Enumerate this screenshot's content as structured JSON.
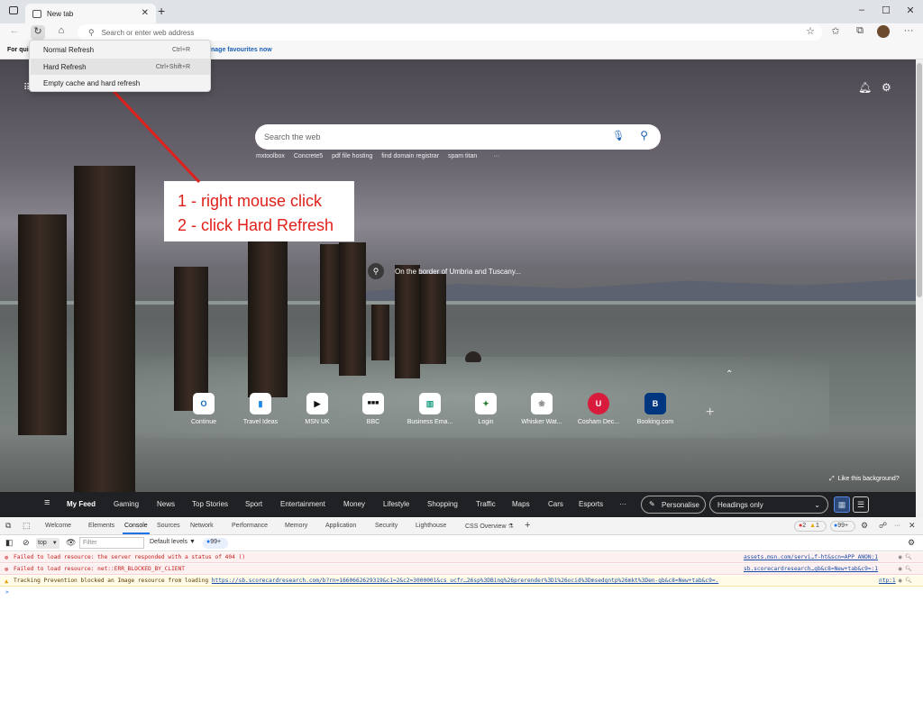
{
  "browser": {
    "tab_title": "New tab",
    "address_placeholder": "Search or enter web address",
    "window_controls": {
      "minimize": "–",
      "maximize": "☐",
      "close": "✕"
    },
    "fav_bar_text": "For qui",
    "fav_bar_link": "nage favourites now"
  },
  "context_menu": {
    "items": [
      {
        "label": "Normal Refresh",
        "shortcut": "Ctrl+R"
      },
      {
        "label": "Hard Refresh",
        "shortcut": "Ctrl+Shift+R"
      },
      {
        "label": "Empty cache and hard refresh",
        "shortcut": ""
      }
    ]
  },
  "ntp": {
    "search_placeholder": "Search the web",
    "suggestions": [
      "mxtoolbox",
      "Concrete5",
      "pdf file hosting",
      "find domain registrar",
      "spam titan",
      "···"
    ],
    "caption": "On the border of Umbria and Tuscany...",
    "like_background": "Like this background?",
    "quick_links": [
      {
        "label": "Continue",
        "icon_text": "O",
        "color": "#0f6cbd"
      },
      {
        "label": "Travel Ideas",
        "icon_text": "▮",
        "color": "#1e88e5"
      },
      {
        "label": "MSN UK",
        "icon_text": "▶",
        "color": "#111111"
      },
      {
        "label": "BBC",
        "icon_text": "■■■",
        "color": "#111111"
      },
      {
        "label": "Business Ema...",
        "icon_text": "▥",
        "color": "#1a9e82"
      },
      {
        "label": "Login",
        "icon_text": "✦",
        "color": "#2e7d32"
      },
      {
        "label": "Whisker Wat...",
        "icon_text": "❀",
        "color": "#888888"
      },
      {
        "label": "Cosham Dec...",
        "icon_text": "U",
        "color": "#d81b3c"
      },
      {
        "label": "Booking.com",
        "icon_text": "B",
        "color": "#003580"
      }
    ]
  },
  "annotation": {
    "line1": "1 - right mouse click",
    "line2": "2 - click Hard Refresh"
  },
  "feed_nav": {
    "items": [
      "My Feed",
      "Gaming",
      "News",
      "Top Stories",
      "Sport",
      "Entertainment",
      "Money",
      "Lifestyle",
      "Shopping",
      "Traffic",
      "Maps",
      "Cars",
      "Esports",
      "···"
    ],
    "personalise": "Personalise",
    "headings": "Headings only"
  },
  "devtools": {
    "tabs": [
      "Welcome",
      "Elements",
      "Console",
      "Sources",
      "Network",
      "Performance",
      "Memory",
      "Application",
      "Security",
      "Lighthouse",
      "CSS Overview ⚗"
    ],
    "badges": {
      "errors": "2",
      "warnings": "1",
      "issues": "99+"
    },
    "context": "top",
    "filter_placeholder": "Filter",
    "levels": "Default levels ▼",
    "issues_small": "99+",
    "console_rows": [
      {
        "level": "error",
        "text": "Failed to load resource: the server responded with a status of 404 ()",
        "source": "assets.msn.com/servi…f-ht&scn=APP_ANON:1"
      },
      {
        "level": "error",
        "text": "Failed to load resource: net::ERR_BLOCKED_BY_CLIENT",
        "source": "sb.scorecardresearch…gb&c8=New+tab&c9=:1"
      },
      {
        "level": "warning",
        "text": "Tracking Prevention blocked an Image resource from loading",
        "link": "https://sb.scorecardresearch.com/b?rn=1660662629319&c1=2&c2=3000001&cs_ucfr…26sp%3DBing%26prerender%3D1%26ocid%3Dmsedgntp%26mkt%3Den-gb&c8=New+tab&c9=.",
        "source": "ntp:1"
      }
    ],
    "prompt": ">"
  }
}
